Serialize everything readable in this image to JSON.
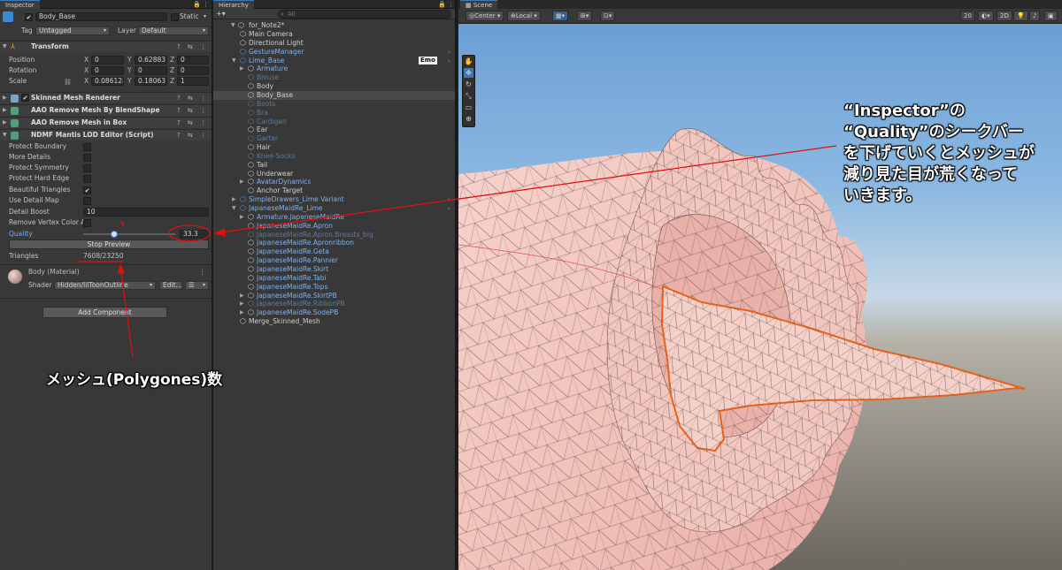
{
  "inspector": {
    "tab_label": "Inspector",
    "object_name": "Body_Base",
    "static_label": "Static",
    "tag_label": "Tag",
    "tag_value": "Untagged",
    "layer_label": "Layer",
    "layer_value": "Default",
    "transform": {
      "title": "Transform",
      "position_label": "Position",
      "rotation_label": "Rotation",
      "scale_label": "Scale",
      "x_label": "X",
      "y_label": "Y",
      "z_label": "Z",
      "position": {
        "x": "0",
        "y": "0.62883",
        "z": "0"
      },
      "rotation": {
        "x": "0",
        "y": "0",
        "z": "0"
      },
      "scale": {
        "x": "0.086128",
        "y": "0.18063",
        "z": "1"
      }
    },
    "components": [
      {
        "name": "Skinned Mesh Renderer"
      },
      {
        "name": "AAO Remove Mesh By BlendShape"
      },
      {
        "name": "AAO Remove Mesh in Box"
      },
      {
        "name": "NDMF Mantis LOD Editor (Script)"
      }
    ],
    "mantis": {
      "protect_boundary": "Protect Boundary",
      "more_details": "More Details",
      "protect_symmetry": "Protect Symmetry",
      "protect_hard_edge": "Protect Hard Edge",
      "beautiful_triangles": "Beautiful Triangles",
      "use_detail_map": "Use Detail Map",
      "detail_boost_label": "Detail Boost",
      "detail_boost_value": "10",
      "remove_vertex_color": "Remove Vertex Color Af",
      "quality_label": "Quality",
      "quality_value": "33.3",
      "quality_fraction": 0.333,
      "stop_preview_label": "Stop Preview",
      "triangles_label": "Triangles",
      "triangles_value": "7608/23250"
    },
    "material": {
      "title": "Body (Material)",
      "shader_label": "Shader",
      "shader_value": "Hidden/lilToonOutline",
      "edit_label": "Edit...",
      "menu_label": "☰"
    },
    "add_component_label": "Add Component"
  },
  "hierarchy": {
    "tab_label": "Hierarchy",
    "add_label": "+▾",
    "search_placeholder": "All",
    "scene_name": "for_Note2*",
    "emo_label": "Emo",
    "items": [
      {
        "label": "Main Camera"
      },
      {
        "label": "Directional Light"
      },
      {
        "label": "GestureManager"
      },
      {
        "label": "Lime_Base"
      },
      {
        "label": "Armature"
      },
      {
        "label": "Blouse"
      },
      {
        "label": "Body"
      },
      {
        "label": "Body_Base"
      },
      {
        "label": "Boots"
      },
      {
        "label": "Bra"
      },
      {
        "label": "Cardigan"
      },
      {
        "label": "Ear"
      },
      {
        "label": "Garter"
      },
      {
        "label": "Hair"
      },
      {
        "label": "Knee-Socks"
      },
      {
        "label": "Tail"
      },
      {
        "label": "Underwear"
      },
      {
        "label": "AvatarDynamics"
      },
      {
        "label": "Anchor Target"
      },
      {
        "label": "SimpleDrawers_Lime Variant"
      },
      {
        "label": "JapaneseMaidRe_Lime"
      },
      {
        "label": "Armature.JapaneseMaidRe"
      },
      {
        "label": "JapaneseMaidRe.Apron"
      },
      {
        "label": "JapaneseMaidRe.Apron.Breasts_big"
      },
      {
        "label": "JapaneseMaidRe.Apronribbon"
      },
      {
        "label": "JapaneseMaidRe.Geta"
      },
      {
        "label": "JapaneseMaidRe.Pannier"
      },
      {
        "label": "JapaneseMaidRe.Skirt"
      },
      {
        "label": "JapaneseMaidRe.Tabi"
      },
      {
        "label": "JapaneseMaidRe.Tops"
      },
      {
        "label": "JapaneseMaidRe.SkirtPB"
      },
      {
        "label": "JapaneseMaidRe.RibbonPB"
      },
      {
        "label": "JapaneseMaidRe.SodePB"
      },
      {
        "label": "Merge_Skinned_Mesh"
      }
    ]
  },
  "scene": {
    "tab_label": "Scene",
    "pivot_label": "Center",
    "space_label": "Local",
    "mode_2d_label": "2D",
    "layers_count": "20"
  },
  "annotations": {
    "note_line1": "“Inspector”の",
    "note_line2": "“Quality”のシークバー",
    "note_line3": "を下げていくとメッシュが",
    "note_line4": "減り見た目が荒くなって",
    "note_line5": "いきます。",
    "mesh_count_label": "メッシュ(Polygones)数"
  },
  "colors": {
    "annotation_red": "#e01010",
    "highlight_orange": "#e8621a",
    "unity_blue": "#3a79bb",
    "sky": "#7fb0dc"
  }
}
